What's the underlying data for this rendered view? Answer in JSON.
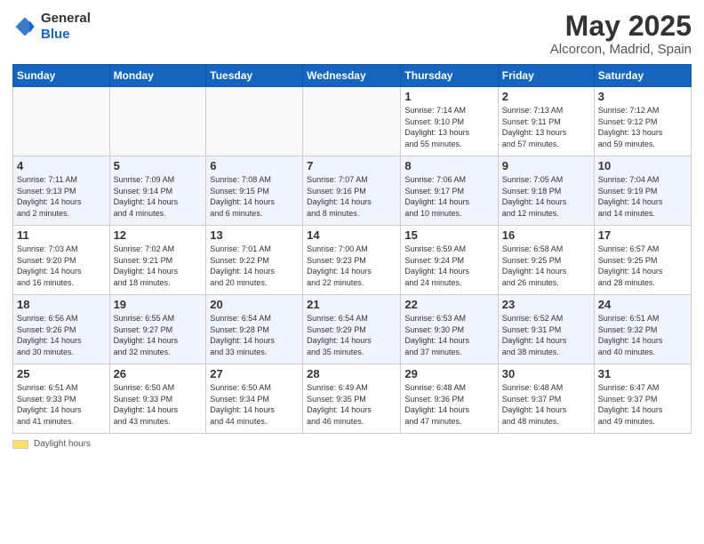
{
  "header": {
    "logo_general": "General",
    "logo_blue": "Blue",
    "month_title": "May 2025",
    "location": "Alcorcon, Madrid, Spain"
  },
  "footer": {
    "swatch_label": "Daylight hours"
  },
  "columns": [
    "Sunday",
    "Monday",
    "Tuesday",
    "Wednesday",
    "Thursday",
    "Friday",
    "Saturday"
  ],
  "weeks": [
    [
      {
        "day": "",
        "info": ""
      },
      {
        "day": "",
        "info": ""
      },
      {
        "day": "",
        "info": ""
      },
      {
        "day": "",
        "info": ""
      },
      {
        "day": "1",
        "info": "Sunrise: 7:14 AM\nSunset: 9:10 PM\nDaylight: 13 hours\nand 55 minutes."
      },
      {
        "day": "2",
        "info": "Sunrise: 7:13 AM\nSunset: 9:11 PM\nDaylight: 13 hours\nand 57 minutes."
      },
      {
        "day": "3",
        "info": "Sunrise: 7:12 AM\nSunset: 9:12 PM\nDaylight: 13 hours\nand 59 minutes."
      }
    ],
    [
      {
        "day": "4",
        "info": "Sunrise: 7:11 AM\nSunset: 9:13 PM\nDaylight: 14 hours\nand 2 minutes."
      },
      {
        "day": "5",
        "info": "Sunrise: 7:09 AM\nSunset: 9:14 PM\nDaylight: 14 hours\nand 4 minutes."
      },
      {
        "day": "6",
        "info": "Sunrise: 7:08 AM\nSunset: 9:15 PM\nDaylight: 14 hours\nand 6 minutes."
      },
      {
        "day": "7",
        "info": "Sunrise: 7:07 AM\nSunset: 9:16 PM\nDaylight: 14 hours\nand 8 minutes."
      },
      {
        "day": "8",
        "info": "Sunrise: 7:06 AM\nSunset: 9:17 PM\nDaylight: 14 hours\nand 10 minutes."
      },
      {
        "day": "9",
        "info": "Sunrise: 7:05 AM\nSunset: 9:18 PM\nDaylight: 14 hours\nand 12 minutes."
      },
      {
        "day": "10",
        "info": "Sunrise: 7:04 AM\nSunset: 9:19 PM\nDaylight: 14 hours\nand 14 minutes."
      }
    ],
    [
      {
        "day": "11",
        "info": "Sunrise: 7:03 AM\nSunset: 9:20 PM\nDaylight: 14 hours\nand 16 minutes."
      },
      {
        "day": "12",
        "info": "Sunrise: 7:02 AM\nSunset: 9:21 PM\nDaylight: 14 hours\nand 18 minutes."
      },
      {
        "day": "13",
        "info": "Sunrise: 7:01 AM\nSunset: 9:22 PM\nDaylight: 14 hours\nand 20 minutes."
      },
      {
        "day": "14",
        "info": "Sunrise: 7:00 AM\nSunset: 9:23 PM\nDaylight: 14 hours\nand 22 minutes."
      },
      {
        "day": "15",
        "info": "Sunrise: 6:59 AM\nSunset: 9:24 PM\nDaylight: 14 hours\nand 24 minutes."
      },
      {
        "day": "16",
        "info": "Sunrise: 6:58 AM\nSunset: 9:25 PM\nDaylight: 14 hours\nand 26 minutes."
      },
      {
        "day": "17",
        "info": "Sunrise: 6:57 AM\nSunset: 9:25 PM\nDaylight: 14 hours\nand 28 minutes."
      }
    ],
    [
      {
        "day": "18",
        "info": "Sunrise: 6:56 AM\nSunset: 9:26 PM\nDaylight: 14 hours\nand 30 minutes."
      },
      {
        "day": "19",
        "info": "Sunrise: 6:55 AM\nSunset: 9:27 PM\nDaylight: 14 hours\nand 32 minutes."
      },
      {
        "day": "20",
        "info": "Sunrise: 6:54 AM\nSunset: 9:28 PM\nDaylight: 14 hours\nand 33 minutes."
      },
      {
        "day": "21",
        "info": "Sunrise: 6:54 AM\nSunset: 9:29 PM\nDaylight: 14 hours\nand 35 minutes."
      },
      {
        "day": "22",
        "info": "Sunrise: 6:53 AM\nSunset: 9:30 PM\nDaylight: 14 hours\nand 37 minutes."
      },
      {
        "day": "23",
        "info": "Sunrise: 6:52 AM\nSunset: 9:31 PM\nDaylight: 14 hours\nand 38 minutes."
      },
      {
        "day": "24",
        "info": "Sunrise: 6:51 AM\nSunset: 9:32 PM\nDaylight: 14 hours\nand 40 minutes."
      }
    ],
    [
      {
        "day": "25",
        "info": "Sunrise: 6:51 AM\nSunset: 9:33 PM\nDaylight: 14 hours\nand 41 minutes."
      },
      {
        "day": "26",
        "info": "Sunrise: 6:50 AM\nSunset: 9:33 PM\nDaylight: 14 hours\nand 43 minutes."
      },
      {
        "day": "27",
        "info": "Sunrise: 6:50 AM\nSunset: 9:34 PM\nDaylight: 14 hours\nand 44 minutes."
      },
      {
        "day": "28",
        "info": "Sunrise: 6:49 AM\nSunset: 9:35 PM\nDaylight: 14 hours\nand 46 minutes."
      },
      {
        "day": "29",
        "info": "Sunrise: 6:48 AM\nSunset: 9:36 PM\nDaylight: 14 hours\nand 47 minutes."
      },
      {
        "day": "30",
        "info": "Sunrise: 6:48 AM\nSunset: 9:37 PM\nDaylight: 14 hours\nand 48 minutes."
      },
      {
        "day": "31",
        "info": "Sunrise: 6:47 AM\nSunset: 9:37 PM\nDaylight: 14 hours\nand 49 minutes."
      }
    ]
  ]
}
